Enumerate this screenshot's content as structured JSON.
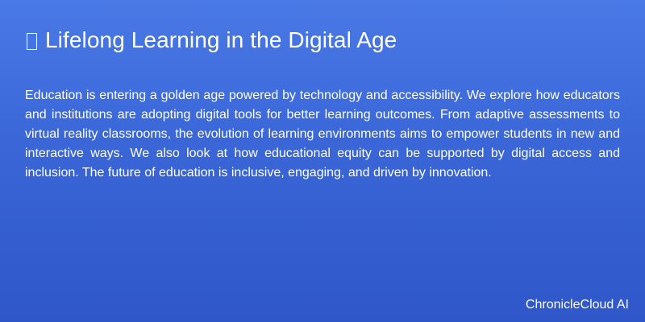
{
  "slide": {
    "title_icon": "missing-glyph-box-icon",
    "title": "Lifelong Learning in the Digital Age",
    "body": "Education is entering a golden age powered by technology and accessibility. We explore how educators and institutions are adopting digital tools for better learning outcomes. From adaptive assessments to virtual reality classrooms, the evolution of learning environments aims to empower students in new and interactive ways. We also look at how educational equity can be supported by digital access and inclusion. The future of education is inclusive, engaging, and driven by innovation.",
    "brand": "ChronicleCloud AI"
  },
  "colors": {
    "background_top": "#4a7ae6",
    "background_bottom": "#2f57c9",
    "text": "#ffffff"
  }
}
